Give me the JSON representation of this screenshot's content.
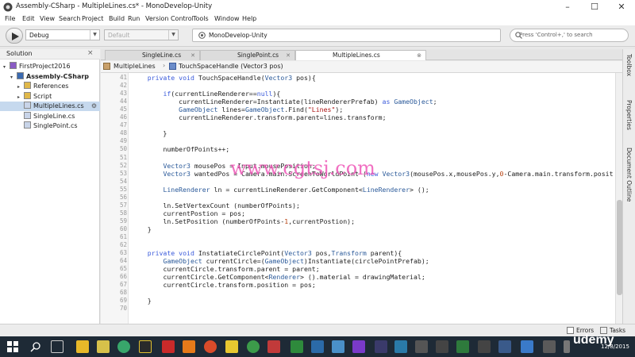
{
  "window": {
    "title": "Assembly-CSharp - MultipleLines.cs* - MonoDevelop-Unity"
  },
  "menu": [
    "File",
    "Edit",
    "View",
    "Search",
    "Project",
    "Build",
    "Run",
    "Version Control",
    "Tools",
    "Window",
    "Help"
  ],
  "toolbar": {
    "config": "Debug",
    "platform": "Default",
    "status": "MonoDevelop-Unity",
    "search_placeholder": "Press 'Control+,' to search"
  },
  "solution": {
    "header": "Solution",
    "items": [
      {
        "label": "FirstProject2016",
        "depth": 0,
        "tri": "▾",
        "icon": "solution"
      },
      {
        "label": "Assembly-CSharp",
        "depth": 1,
        "tri": "▾",
        "icon": "project",
        "bold": true
      },
      {
        "label": "References",
        "depth": 2,
        "tri": "▸",
        "icon": "folder"
      },
      {
        "label": "Script",
        "depth": 2,
        "tri": "▸",
        "icon": "folder"
      },
      {
        "label": "MultipleLines.cs",
        "depth": 2,
        "tri": "",
        "icon": "file",
        "selected": true
      },
      {
        "label": "SingleLine.cs",
        "depth": 2,
        "tri": "",
        "icon": "file"
      },
      {
        "label": "SinglePoint.cs",
        "depth": 2,
        "tri": "",
        "icon": "file"
      }
    ]
  },
  "tabs": [
    {
      "label": "SingleLine.cs",
      "active": false
    },
    {
      "label": "SinglePoint.cs",
      "active": false
    },
    {
      "label": "MultipleLines.cs",
      "active": true
    }
  ],
  "path": {
    "class": "MultipleLines",
    "member": "TouchSpaceHandle (Vector3 pos)"
  },
  "code": [
    {
      "n": "41",
      "t": "    private void TouchSpaceHandle(Vector3 pos){"
    },
    {
      "n": "42",
      "t": ""
    },
    {
      "n": "43",
      "t": "        if(currentLineRenderer==null){"
    },
    {
      "n": "44",
      "t": "            currentLineRenderer=Instantiate(lineRendererPrefab) as GameObject;"
    },
    {
      "n": "45",
      "t": "            GameObject lines=GameObject.Find(\"Lines\");"
    },
    {
      "n": "46",
      "t": "            currentLineRenderer.transform.parent=lines.transform;"
    },
    {
      "n": "47",
      "t": ""
    },
    {
      "n": "48",
      "t": "        }"
    },
    {
      "n": "49",
      "t": ""
    },
    {
      "n": "50",
      "t": "        numberOfPoints++;"
    },
    {
      "n": "51",
      "t": ""
    },
    {
      "n": "52",
      "t": "        Vector3 mousePos = Input.mousePosition;"
    },
    {
      "n": "53",
      "t": "        Vector3 wantedPos = Camera.main.ScreenToWorldPoint (new Vector3(mousePos.x,mousePos.y,0-Camera.main.transform.posit"
    },
    {
      "n": "54",
      "t": ""
    },
    {
      "n": "55",
      "t": "        LineRenderer ln = currentLineRenderer.GetComponent<LineRenderer> ();"
    },
    {
      "n": "56",
      "t": ""
    },
    {
      "n": "57",
      "t": "        ln.SetVertexCount (numberOfPoints);"
    },
    {
      "n": "58",
      "t": "        currentPostion = pos;"
    },
    {
      "n": "59",
      "t": "        ln.SetPosition (numberOfPoints-1,currentPostion);"
    },
    {
      "n": "60",
      "t": "    }"
    },
    {
      "n": "61",
      "t": ""
    },
    {
      "n": "62",
      "t": ""
    },
    {
      "n": "63",
      "t": "    private void InstatiateCirclePoint(Vector3 pos,Transform parent){"
    },
    {
      "n": "64",
      "t": "        GameObject currentCircle=(GameObject)Instantiate(circlePointPrefab);"
    },
    {
      "n": "65",
      "t": "        currentCircle.transform.parent = parent;"
    },
    {
      "n": "66",
      "t": "        currentCircle.GetComponent<Renderer> ().material = drawingMaterial;"
    },
    {
      "n": "67",
      "t": "        currentCircle.transform.position = pos;"
    },
    {
      "n": "68",
      "t": ""
    },
    {
      "n": "69",
      "t": "    }"
    },
    {
      "n": "70",
      "t": ""
    }
  ],
  "right_panels": [
    "Toolbox",
    "Properties",
    "Document Outline"
  ],
  "status_items": {
    "errors": "Errors",
    "tasks": "Tasks"
  },
  "watermark": "www.cgtsj.com",
  "taskbar": {
    "brand": "udemy",
    "date": "12/8/2015"
  },
  "colors": {
    "keyword": "#3b5bdb",
    "type": "#2b5a9a",
    "string": "#aa1111",
    "number": "#b7410e"
  }
}
